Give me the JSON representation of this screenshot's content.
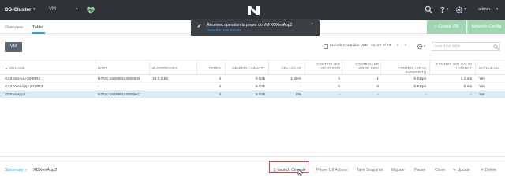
{
  "topbar": {
    "cluster": "DS-Cluster",
    "entity": "VM",
    "user": "admin",
    "icons": [
      "heart-health-icon",
      "nutanix-logo",
      "search-icon",
      "help-icon",
      "gear-icon"
    ]
  },
  "subnav": {
    "tabs": [
      "Overview",
      "Table"
    ],
    "separator": "·",
    "active_tab": "Table",
    "create_vm": "+ Create VM",
    "network_config": "Network Config"
  },
  "notification": {
    "message": "Received operation to power on VM XDXenApp2",
    "link": "View the task details",
    "close": "×"
  },
  "toolbar": {
    "filter": "VM",
    "include_cvm_label": "Include Controller VMs",
    "include_cvm_checked": false,
    "range": "21–23 of 23",
    "search_placeholder": "search in table"
  },
  "table": {
    "columns": [
      "▲ VM NAME",
      "HOST",
      "IP ADDRESSES",
      "CORES",
      "MEMORY CAPACITY",
      "CPU USAGE",
      "CONTROLLER READ IOPS",
      "CONTROLLER WRITE IOPS",
      "CONTROLLER IO BANDWIDTH",
      "CONTROLLER AVG IO LATENCY",
      "BACKUP AN..."
    ],
    "rows": [
      {
        "name": "XAXXenApp-2008R2",
        "host": "NTNX-15SM65340069-B",
        "ip": "10.0.0.56",
        "cores": "4",
        "memory": "8 GiB",
        "cpu": "1.55%",
        "read_iops": "0",
        "write_iops": "1",
        "bandwidth": "5 KBps",
        "latency": "1.1 ms",
        "backup": "Yes",
        "selected": false
      },
      {
        "name": "XAXSXenApp-2012R2",
        "host": "-",
        "ip": "",
        "cores": "4",
        "memory": "8 GiB",
        "cpu": "-",
        "read_iops": "0",
        "write_iops": "0",
        "bandwidth": "0 KBps",
        "latency": "0 ms",
        "backup": "Yes",
        "selected": false
      },
      {
        "name": "XDXenApp2",
        "host": "NTNX-15SM65340069-C",
        "ip": "",
        "cores": "4",
        "memory": "8 GiB",
        "cpu": "0%",
        "read_iops": "-",
        "write_iops": "-",
        "bandwidth": "-",
        "latency": "-",
        "backup": "Yes",
        "selected": true
      }
    ]
  },
  "footer": {
    "breadcrumb_summary": "Summary",
    "breadcrumb_sep": "›",
    "breadcrumb_vm": "XDXenApp2",
    "actions": [
      "Launch Console",
      "Power Off Actions",
      "Take Snapshot",
      "Migrate",
      "Pause",
      "Clone",
      "Update",
      "Delete"
    ]
  },
  "colors": {
    "topbar": "#2f3338",
    "accent": "#22a5f7",
    "create_button": "#9fd6b1",
    "selected_row": "#d8ecf9",
    "highlight_box": "#e0403a",
    "health": "#8fd19e"
  }
}
